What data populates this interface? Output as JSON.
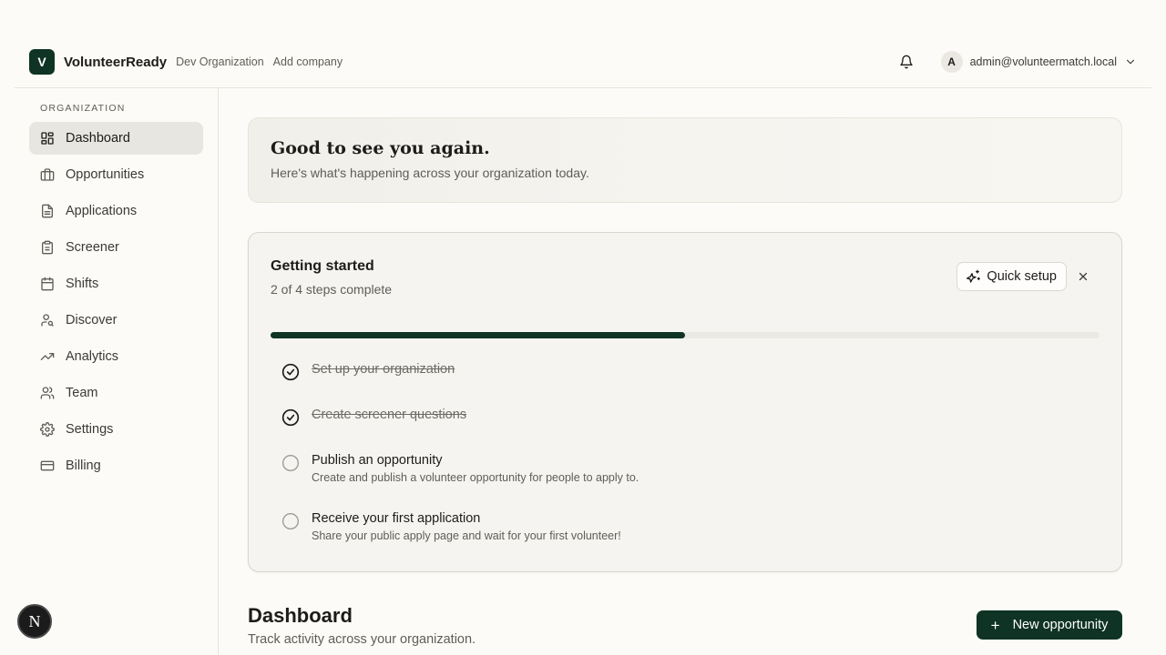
{
  "header": {
    "logo_letter": "V",
    "brand": "VolunteerReady",
    "organization": "Dev Organization",
    "add_company": "Add company",
    "user_initial": "A",
    "user_email": "admin@volunteermatch.local"
  },
  "sidebar": {
    "heading": "ORGANIZATION",
    "items": [
      {
        "label": "Dashboard",
        "icon": "dashboard-grid-icon",
        "active": true
      },
      {
        "label": "Opportunities",
        "icon": "briefcase-icon"
      },
      {
        "label": "Applications",
        "icon": "document-icon"
      },
      {
        "label": "Screener",
        "icon": "clipboard-icon"
      },
      {
        "label": "Shifts",
        "icon": "calendar-icon"
      },
      {
        "label": "Discover",
        "icon": "user-search-icon"
      },
      {
        "label": "Analytics",
        "icon": "trending-up-icon"
      },
      {
        "label": "Team",
        "icon": "users-icon"
      },
      {
        "label": "Settings",
        "icon": "gear-icon"
      },
      {
        "label": "Billing",
        "icon": "credit-card-icon"
      }
    ]
  },
  "welcome": {
    "title": "Good to see you again.",
    "subtitle": "Here's what's happening across your organization today."
  },
  "getting_started": {
    "title": "Getting started",
    "progress_text": "2 of 4 steps complete",
    "progress_fraction": 0.5,
    "quick_setup_label": "Quick setup",
    "steps": [
      {
        "title": "Set up your organization",
        "description": "",
        "done": true
      },
      {
        "title": "Create screener questions",
        "description": "",
        "done": true
      },
      {
        "title": "Publish an opportunity",
        "description": "Create and publish a volunteer opportunity for people to apply to.",
        "done": false
      },
      {
        "title": "Receive your first application",
        "description": "Share your public apply page and wait for your first volunteer!",
        "done": false
      }
    ]
  },
  "dashboard": {
    "title": "Dashboard",
    "subtitle": "Track activity across your organization.",
    "new_button": "New opportunity"
  },
  "dev_badge": "N",
  "colors": {
    "accent": "#0f3324",
    "background": "#fdfbf7"
  }
}
